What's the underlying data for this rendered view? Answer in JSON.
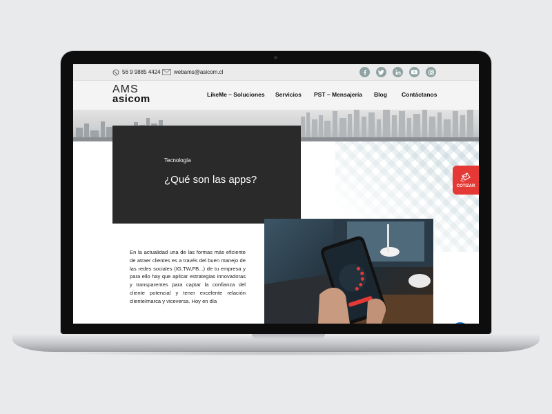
{
  "topbar": {
    "phone": "56 9 9885 4424",
    "email": "webams@asicom.cl",
    "socials": [
      "facebook-icon",
      "twitter-icon",
      "linkedin-icon",
      "youtube-icon",
      "instagram-icon"
    ]
  },
  "logo": {
    "line1": "AMS",
    "line2": "asicom"
  },
  "nav": {
    "items": [
      {
        "label": "LikeMe – Soluciones"
      },
      {
        "label": "Servicios"
      },
      {
        "label": "PST – Mensajería"
      },
      {
        "label": "Blog"
      },
      {
        "label": "Contáctanos"
      }
    ]
  },
  "post": {
    "category": "Tecnología",
    "title": "¿Qué son las apps?",
    "body": "En la actualidad una de las formas más eficiente de atraer clientes es a través del buen manejo de las redes sociales (IG,TW,FB...) de tu empresa y para ello hay que aplicar estrategias innovadoras y transparentes para captar la confianza del cliente potencial y tener excelente relación cliente/marca y viceversa. Hoy en día"
  },
  "cotizar": {
    "label": "COTIZAR"
  },
  "colors": {
    "accent_red": "#e53935",
    "social_teal": "#8fa2a2",
    "dark_box": "#2a2a2a"
  }
}
